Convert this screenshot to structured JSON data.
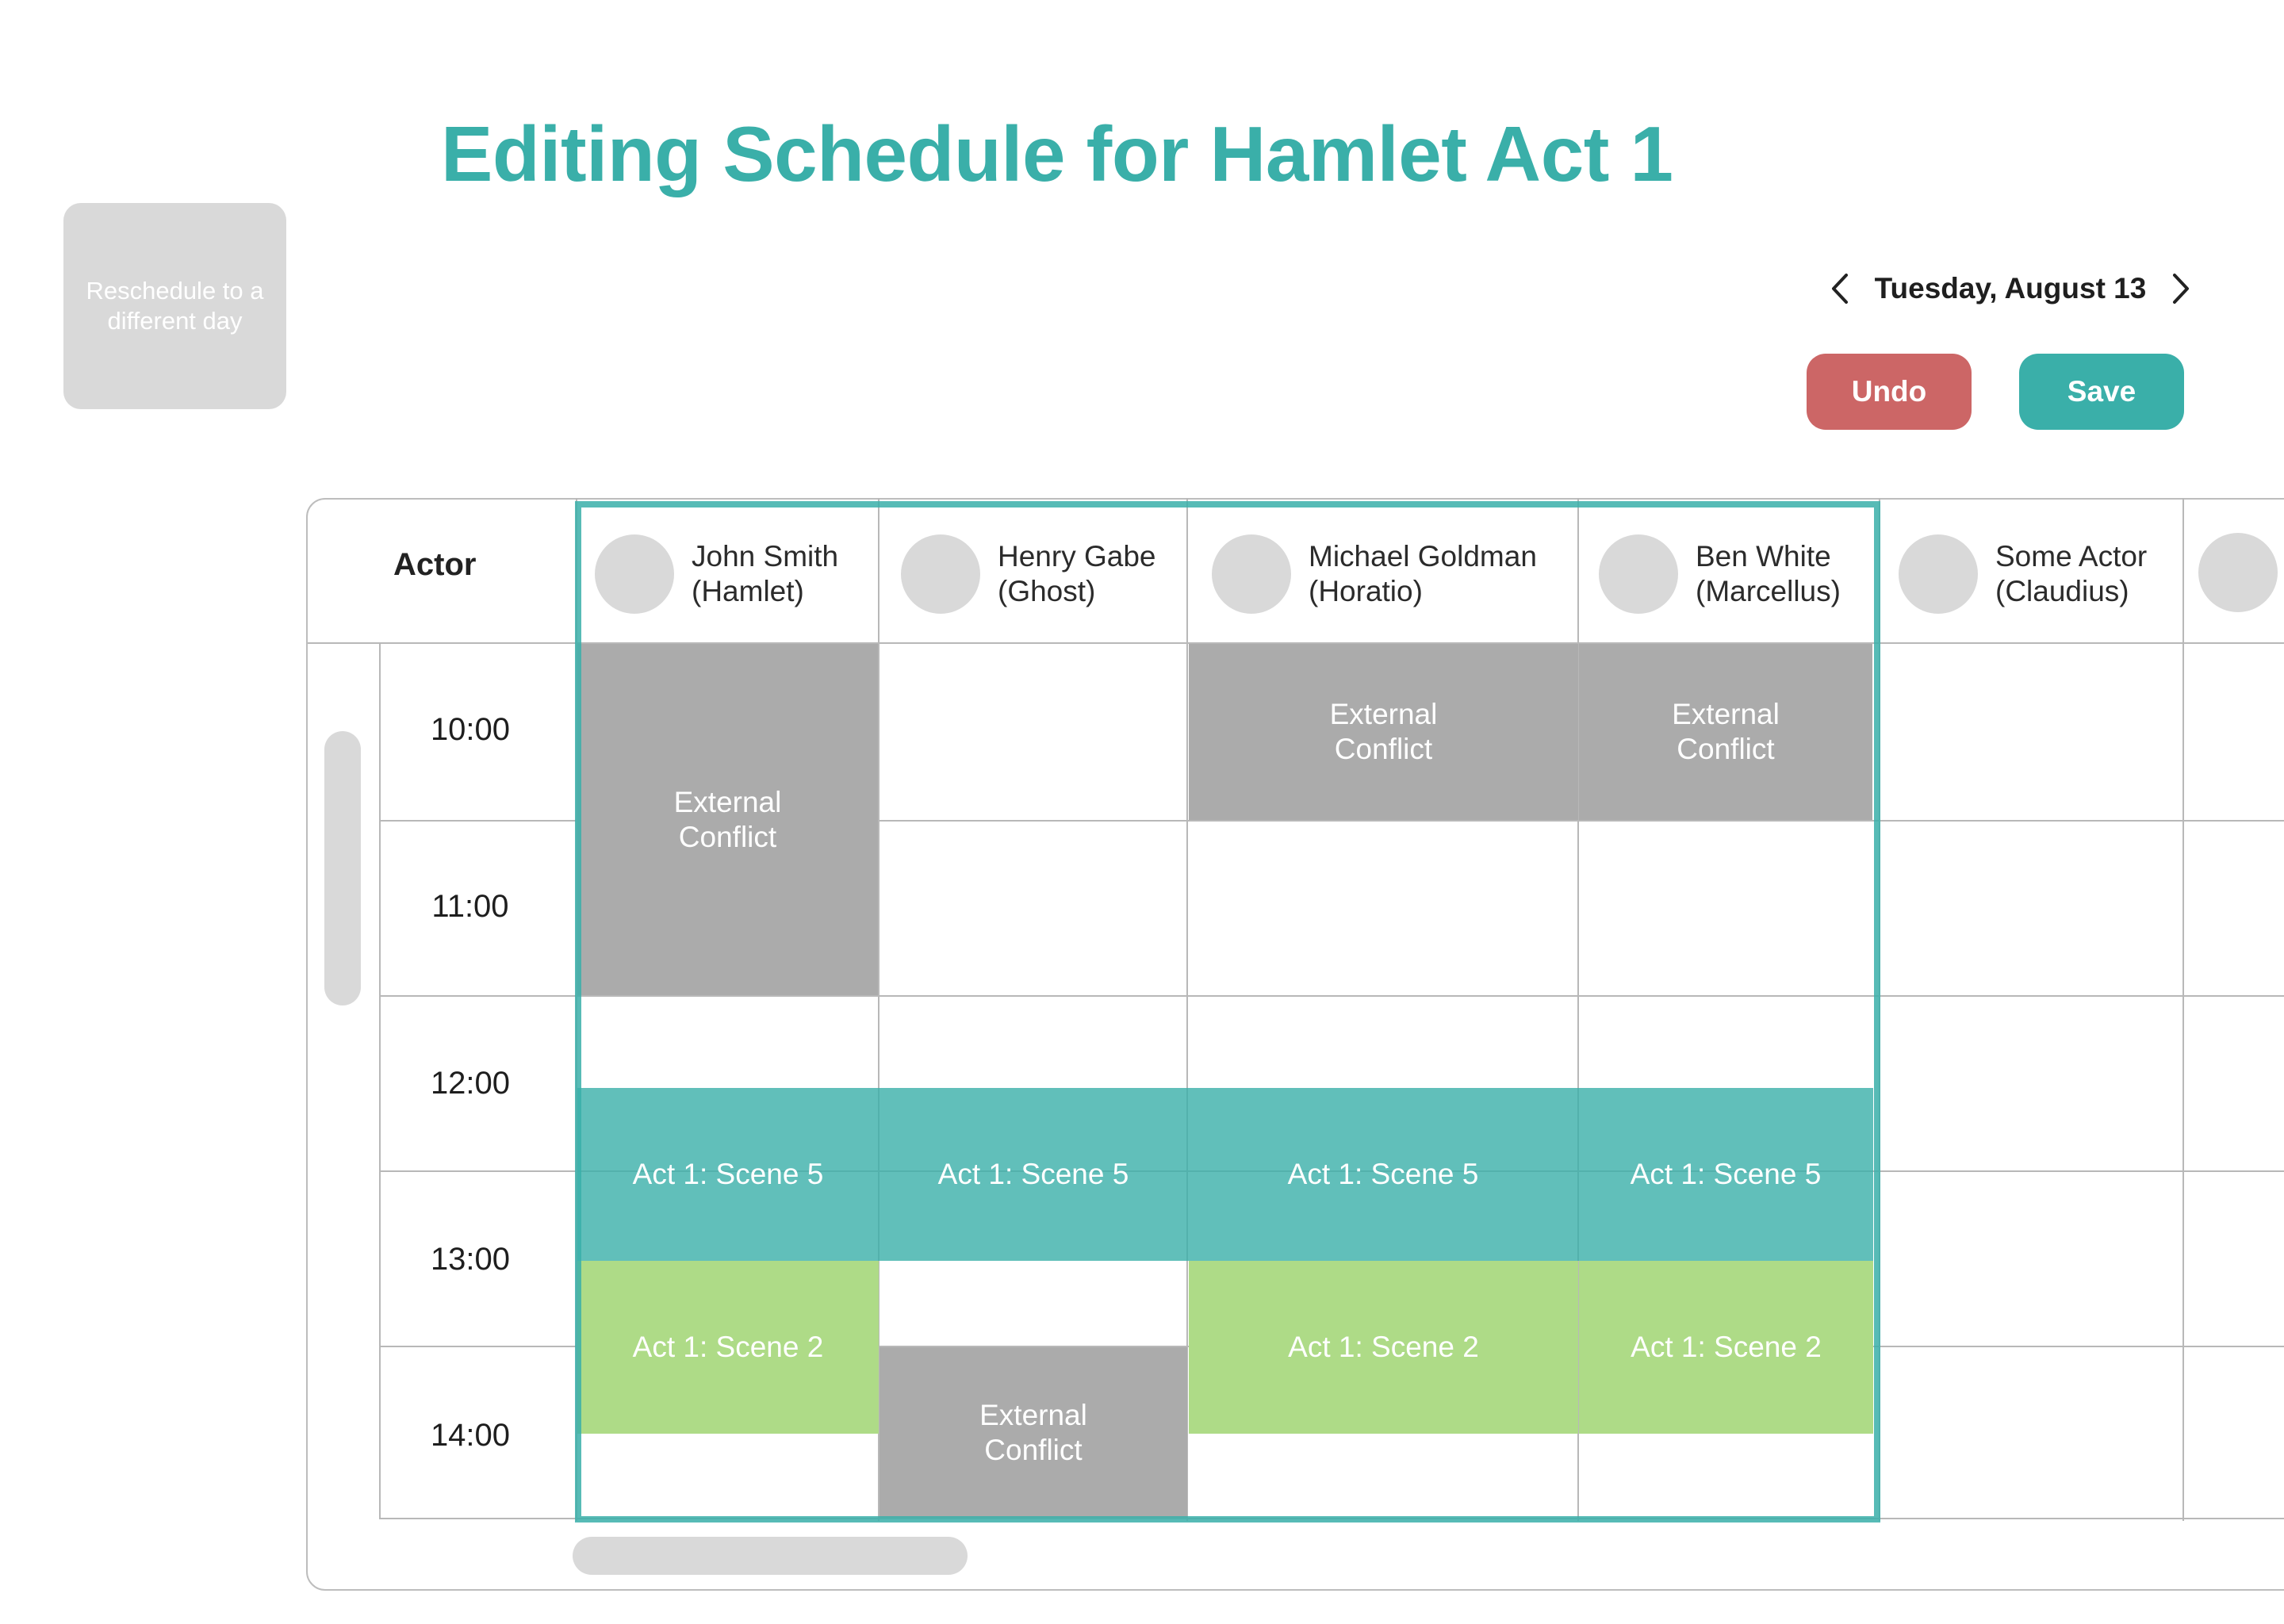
{
  "page": {
    "title": "Editing Schedule for Hamlet Act 1"
  },
  "sidebar": {
    "reschedule_label": "Reschedule to a different day"
  },
  "date_nav": {
    "date": "Tuesday, August 13",
    "prev_icon": "chevron-left-icon",
    "next_icon": "chevron-right-icon"
  },
  "toolbar": {
    "undo_label": "Undo",
    "save_label": "Save"
  },
  "colors": {
    "accent": "#3aafa9",
    "undo": "#cc6666",
    "conflict": "#ababab",
    "scene_5": "#5fbeb9",
    "scene_2": "#aedb87",
    "disabled": "#d9d9d9"
  },
  "table": {
    "actor_header": "Actor",
    "actors": [
      {
        "name": "John Smith",
        "role": "(Hamlet)"
      },
      {
        "name": "Henry Gabe",
        "role": "(Ghost)"
      },
      {
        "name": "Michael Goldman",
        "role": "(Horatio)"
      },
      {
        "name": "Ben White",
        "role": "(Marcellus)"
      },
      {
        "name": "Some Actor",
        "role": "(Claudius)"
      }
    ],
    "times": [
      "10:00",
      "11:00",
      "12:00",
      "13:00",
      "14:00"
    ],
    "blocks": {
      "external_conflict": "External Conflict",
      "act1_scene5": "Act 1: Scene 5",
      "act1_scene2": "Act 1: Scene 2"
    }
  }
}
